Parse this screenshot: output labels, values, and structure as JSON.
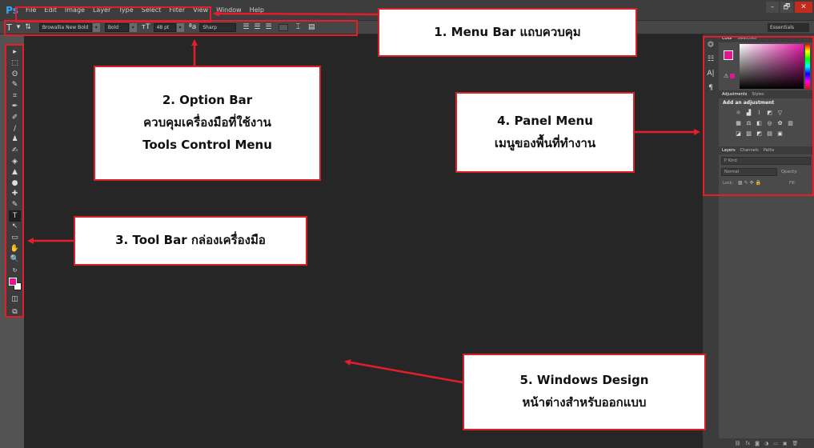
{
  "app": {
    "logo": "Ps",
    "menu": [
      "File",
      "Edit",
      "Image",
      "Layer",
      "Type",
      "Select",
      "Filter",
      "View",
      "Window",
      "Help"
    ],
    "window_controls": [
      "–",
      "🗗",
      "✕"
    ]
  },
  "options_bar": {
    "tool_glyph": "T",
    "font_family": "Browallia New Bold",
    "font_style": "Bold",
    "font_size": "48 pt",
    "antialias": "Sharp",
    "workspace": "Essentials"
  },
  "toolbar": {
    "tools": [
      "▸",
      "⬚",
      "ʘ",
      "✎",
      "⌗",
      "✒",
      "✐",
      "/",
      "♟",
      "✍",
      "◈",
      "▲",
      "●",
      "✚",
      "✎",
      "T",
      "↖",
      "▭",
      "✋",
      "🔍",
      "↻"
    ]
  },
  "panels": {
    "color_tabs": [
      "Color",
      "Swatches"
    ],
    "adjust_tabs": [
      "Adjustments",
      "Styles"
    ],
    "adjust_title": "Add an adjustment",
    "layers_tabs": [
      "Layers",
      "Channels",
      "Paths"
    ],
    "layers_kind": "P Kind",
    "blend_mode": "Normal",
    "opacity_label": "Opacity:",
    "lock_label": "Lock:",
    "fill_label": "Fill:"
  },
  "callouts": {
    "c1": {
      "line1": "1. Menu Bar แถบควบคุม"
    },
    "c2": {
      "line1": "2. Option Bar",
      "line2": "ควบคุมเครื่องมือที่ใช้งาน",
      "line3": "Tools Control Menu"
    },
    "c3": {
      "line1": "3. Tool Bar กล่องเครื่องมือ"
    },
    "c4": {
      "line1": "4. Panel Menu",
      "line2": "เมนูของพื้นที่ทำงาน"
    },
    "c5": {
      "line1": "5. Windows Design",
      "line2": "หน้าต่างสำหรับออกแบบ"
    }
  },
  "colors": {
    "highlight": "#e41d2a",
    "foreground": "#e4168f",
    "canvas": "#262626"
  }
}
